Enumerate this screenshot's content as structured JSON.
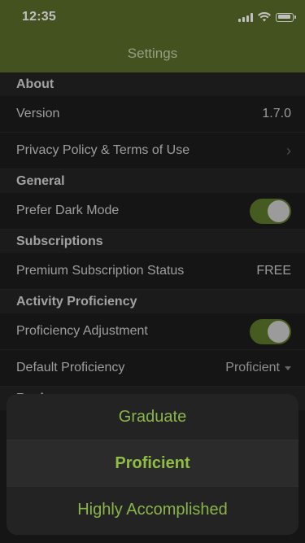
{
  "status_bar": {
    "time": "12:35"
  },
  "nav": {
    "title": "Settings"
  },
  "sections": {
    "about": {
      "header": "About",
      "version_label": "Version",
      "version_value": "1.7.0",
      "privacy_label": "Privacy Policy & Terms of Use"
    },
    "general": {
      "header": "General",
      "dark_mode_label": "Prefer Dark Mode",
      "dark_mode_on": true
    },
    "subscriptions": {
      "header": "Subscriptions",
      "status_label": "Premium Subscription Status",
      "status_value": "FREE"
    },
    "activity": {
      "header": "Activity Proficiency",
      "adjustment_label": "Proficiency Adjustment",
      "adjustment_on": true,
      "default_label": "Default Proficiency",
      "default_value": "Proficient"
    },
    "backups": {
      "header": "Backups"
    }
  },
  "action_sheet": {
    "options": [
      "Graduate",
      "Proficient",
      "Highly Accomplished"
    ],
    "selected": "Proficient"
  },
  "colors": {
    "header_bg": "#5b6e2a",
    "accent_green": "#8ab54a",
    "toggle_on": "#5d7a2a"
  }
}
